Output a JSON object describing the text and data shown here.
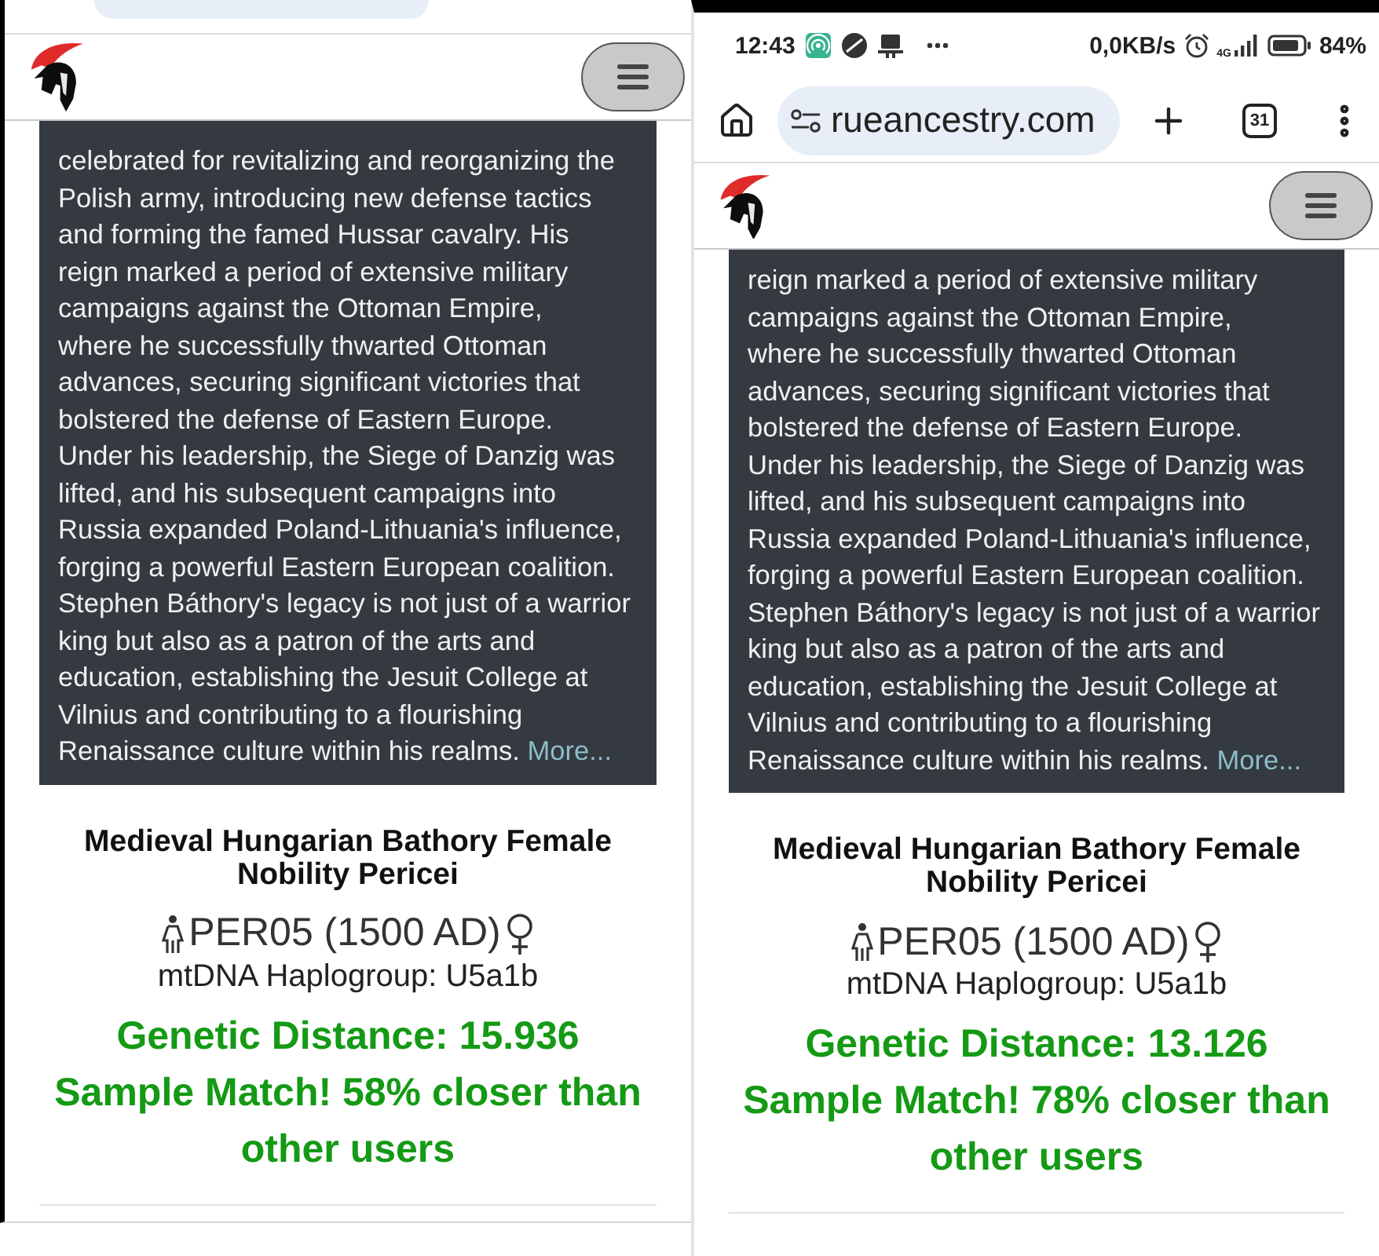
{
  "panels": [
    {
      "address_bar": {
        "cut_off": true
      },
      "description": {
        "lines": [
          "celebrated for revitalizing and reorganizing the",
          "Polish army, introducing new defense tactics",
          "and forming the famed Hussar cavalry. His",
          "reign marked a period of extensive military",
          "campaigns against the Ottoman Empire,",
          "where he successfully thwarted Ottoman",
          "advances, securing significant victories that",
          "bolstered the defense of Eastern Europe.",
          "Under his leadership, the Siege of Danzig was",
          "lifted, and his subsequent campaigns into",
          "Russia expanded Poland-Lithuania's influence,",
          "forging a powerful Eastern European coalition.",
          "Stephen Báthory's legacy is not just of a warrior",
          "king but also as a patron of the arts and",
          "education, establishing the Jesuit College at",
          "Vilnius and contributing to a flourishing",
          "Renaissance culture within his realms."
        ],
        "more_link": "More..."
      },
      "sample": {
        "title": "Medieval Hungarian Bathory Female Nobility Pericei",
        "sample_id": "PER05 (1500 AD)",
        "haplogroup": "mtDNA Haplogroup: U5a1b",
        "genetic_distance": "Genetic Distance: 15.936",
        "match": "Sample Match! 58% closer than other users"
      }
    },
    {
      "status_bar": {
        "time": "12:43",
        "network_speed": "0,0KB/s",
        "network_type": "4G",
        "battery": "84%"
      },
      "address_bar": {
        "cut_off": false,
        "url": "rueancestry.com",
        "tab_count": "31"
      },
      "description": {
        "lines": [
          "reign marked a period of extensive military",
          "campaigns against the Ottoman Empire,",
          "where he successfully thwarted Ottoman",
          "advances, securing significant victories that",
          "bolstered the defense of Eastern Europe.",
          "Under his leadership, the Siege of Danzig was",
          "lifted, and his subsequent campaigns into",
          "Russia expanded Poland-Lithuania's influence,",
          "forging a powerful Eastern European coalition.",
          "Stephen Báthory's legacy is not just of a warrior",
          "king but also as a patron of the arts and",
          "education, establishing the Jesuit College at",
          "Vilnius and contributing to a flourishing",
          "Renaissance culture within his realms."
        ],
        "more_link": "More..."
      },
      "sample": {
        "title": "Medieval Hungarian Bathory Female Nobility Pericei",
        "sample_id": "PER05 (1500 AD)",
        "haplogroup": "mtDNA Haplogroup: U5a1b",
        "genetic_distance": "Genetic Distance: 13.126",
        "match": "Sample Match! 78% closer than other users"
      }
    }
  ]
}
